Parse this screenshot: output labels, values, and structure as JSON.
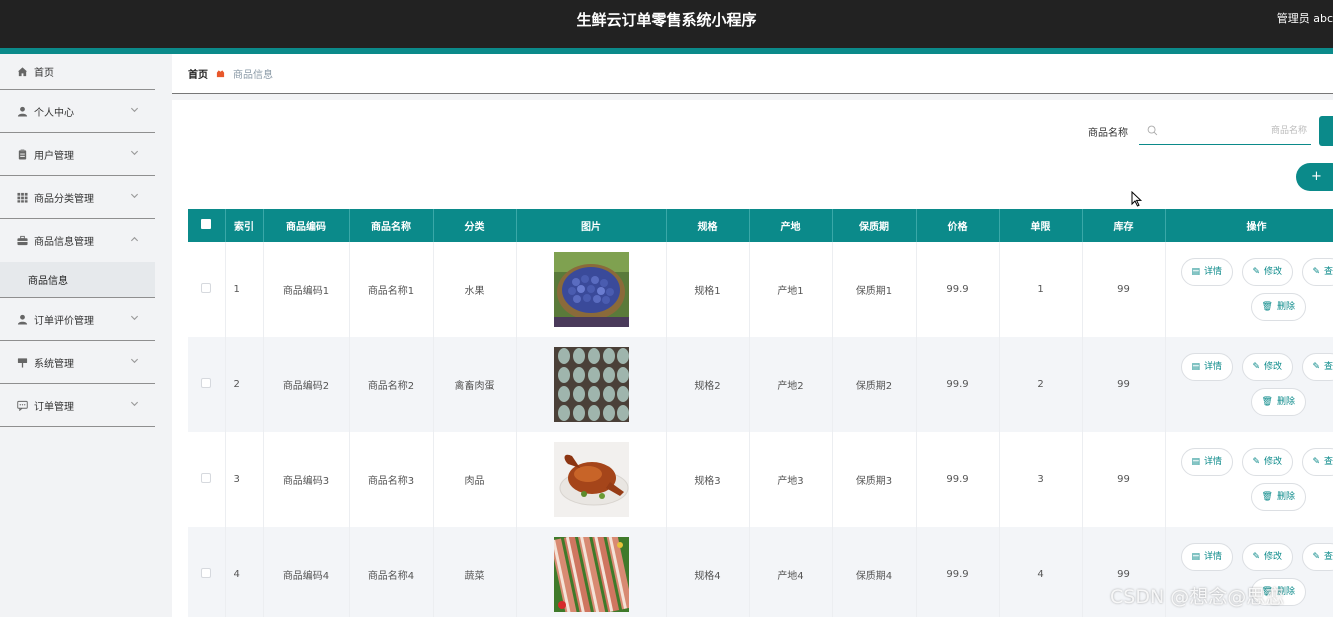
{
  "header": {
    "title": "生鲜云订单零售系统小程序",
    "user": "管理员 abc"
  },
  "sidebar": {
    "items": [
      {
        "label": "首页",
        "icon": "home-icon"
      },
      {
        "label": "个人中心",
        "icon": "person-icon"
      },
      {
        "label": "用户管理",
        "icon": "clipboard-icon"
      },
      {
        "label": "商品分类管理",
        "icon": "grid-icon"
      },
      {
        "label": "商品信息管理",
        "icon": "briefcase-icon"
      },
      {
        "label": "订单评价管理",
        "icon": "person-icon"
      },
      {
        "label": "系统管理",
        "icon": "sign-icon"
      },
      {
        "label": "订单管理",
        "icon": "chat-icon"
      }
    ],
    "submenu": {
      "label": "商品信息"
    }
  },
  "breadcrumb": {
    "home": "首页",
    "current": "商品信息"
  },
  "search": {
    "label": "商品名称",
    "placeholder": "商品名称",
    "value": ""
  },
  "add_button": {
    "label": "+"
  },
  "table": {
    "headers": [
      "索引",
      "商品编码",
      "商品名称",
      "分类",
      "图片",
      "规格",
      "产地",
      "保质期",
      "价格",
      "单限",
      "库存",
      "操作"
    ],
    "rows": [
      {
        "index": "1",
        "code": "商品编码1",
        "name": "商品名称1",
        "category": "水果",
        "spec": "规格1",
        "origin": "产地1",
        "shelf": "保质期1",
        "price": "99.9",
        "limit": "1",
        "stock": "99",
        "image": "blueberries"
      },
      {
        "index": "2",
        "code": "商品编码2",
        "name": "商品名称2",
        "category": "禽畜肉蛋",
        "spec": "规格2",
        "origin": "产地2",
        "shelf": "保质期2",
        "price": "99.9",
        "limit": "2",
        "stock": "99",
        "image": "eggs"
      },
      {
        "index": "3",
        "code": "商品编码3",
        "name": "商品名称3",
        "category": "肉品",
        "spec": "规格3",
        "origin": "产地3",
        "shelf": "保质期3",
        "price": "99.9",
        "limit": "3",
        "stock": "99",
        "image": "roast-duck"
      },
      {
        "index": "4",
        "code": "商品编码4",
        "name": "商品名称4",
        "category": "蔬菜",
        "spec": "规格4",
        "origin": "产地4",
        "shelf": "保质期4",
        "price": "99.9",
        "limit": "4",
        "stock": "99",
        "image": "pork-belly"
      }
    ],
    "actions": {
      "detail": "详情",
      "edit": "修改",
      "third": "查",
      "delete": "删除"
    }
  },
  "watermark": "CSDN @想念@思恋",
  "colors": {
    "accent": "#0b8a8a",
    "topbar": "#222222"
  }
}
